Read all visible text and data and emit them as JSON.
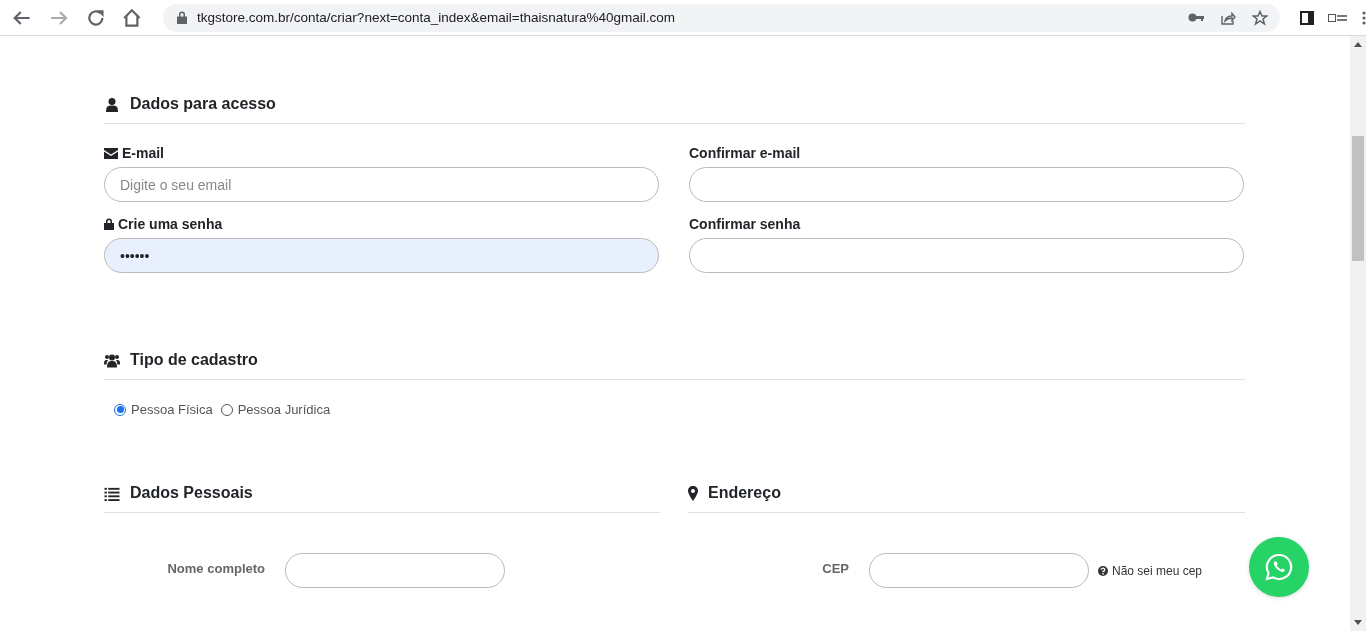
{
  "browser": {
    "url": "tkgstore.com.br/conta/criar?next=conta_index&email=thaisnatura%40gmail.com",
    "forward_disabled": true
  },
  "access": {
    "title": "Dados para acesso",
    "fields": [
      {
        "label": "E-mail",
        "kind": "email",
        "placeholder": "Digite o seu email"
      },
      {
        "label": "Confirmar e-mail"
      },
      {
        "label": "Crie uma senha",
        "kind": "password",
        "value": "••••••",
        "autofilled": true
      },
      {
        "label": "Confirmar senha"
      }
    ]
  },
  "registration_type": {
    "title": "Tipo de cadastro",
    "options": [
      {
        "label": "Pessoa Física",
        "selected": true
      },
      {
        "label": "Pessoa Jurídica",
        "selected": false
      }
    ]
  },
  "personal": {
    "title": "Dados Pessoais",
    "fields": [
      {
        "label": "Nome completo"
      }
    ]
  },
  "address": {
    "title": "Endereço",
    "fields": [
      {
        "label": "CEP",
        "help": "Não sei meu cep"
      }
    ]
  }
}
